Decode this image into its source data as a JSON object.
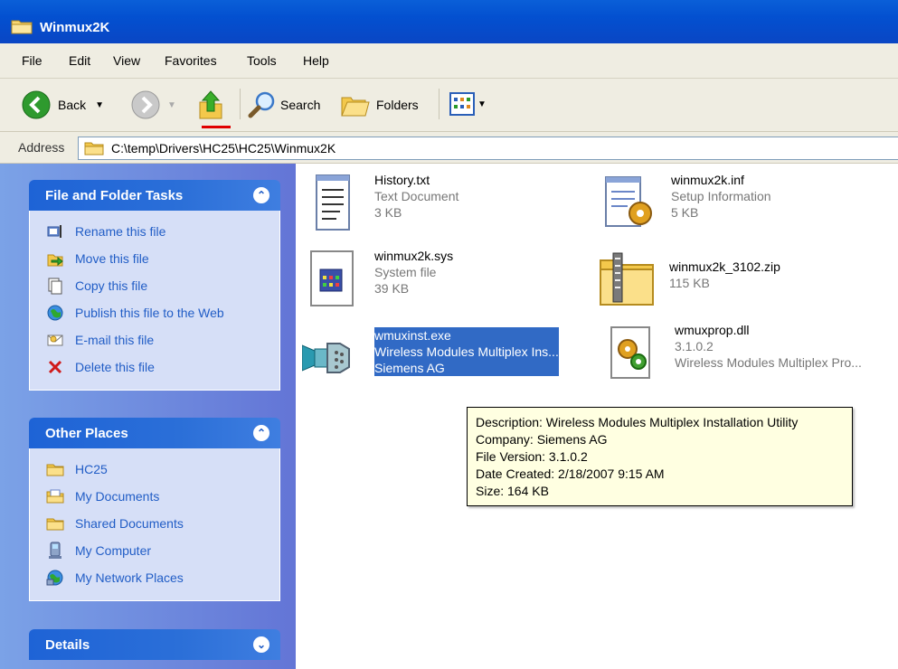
{
  "window": {
    "title": "Winmux2K"
  },
  "menu": [
    "File",
    "Edit",
    "View",
    "Favorites",
    "Tools",
    "Help"
  ],
  "toolbar": {
    "back": "Back",
    "search": "Search",
    "folders": "Folders"
  },
  "address": {
    "label": "Address",
    "path": "C:\\temp\\Drivers\\HC25\\HC25\\Winmux2K"
  },
  "tasks": {
    "title": "File and Folder Tasks",
    "items": [
      "Rename this file",
      "Move this file",
      "Copy this file",
      "Publish this file to the Web",
      "E-mail this file",
      "Delete this file"
    ]
  },
  "places": {
    "title": "Other Places",
    "items": [
      "HC25",
      "My Documents",
      "Shared Documents",
      "My Computer",
      "My Network Places"
    ]
  },
  "details": {
    "title": "Details"
  },
  "files": [
    {
      "name": "History.txt",
      "l2": "Text Document",
      "l3": "3 KB",
      "icon": "text-document-icon"
    },
    {
      "name": "winmux2k.inf",
      "l2": "Setup Information",
      "l3": "5 KB",
      "icon": "setup-information-icon"
    },
    {
      "name": "winmux2k.sys",
      "l2": "System file",
      "l3": "39 KB",
      "icon": "system-file-icon"
    },
    {
      "name": "winmux2k_3102.zip",
      "l2": "115 KB",
      "l3": "",
      "icon": "zip-folder-icon"
    },
    {
      "name": "wmuxinst.exe",
      "l2": "Wireless Modules Multiplex Ins...",
      "l3": "Siemens AG",
      "icon": "serial-connector-icon"
    },
    {
      "name": "wmuxprop.dll",
      "l2": "3.1.0.2",
      "l3": "Wireless Modules Multiplex Pro...",
      "icon": "dll-gear-icon"
    }
  ],
  "tooltip": {
    "lines": [
      "Description: Wireless Modules Multiplex Installation Utility",
      "Company: Siemens AG",
      "File Version: 3.1.0.2",
      "Date Created: 2/18/2007 9:15 AM",
      "Size: 164 KB"
    ]
  },
  "colors": {
    "title_bar": "#0350d0",
    "task_pane_link": "#215dc6",
    "selection": "#316ac5",
    "tooltip_bg": "#ffffe1"
  }
}
